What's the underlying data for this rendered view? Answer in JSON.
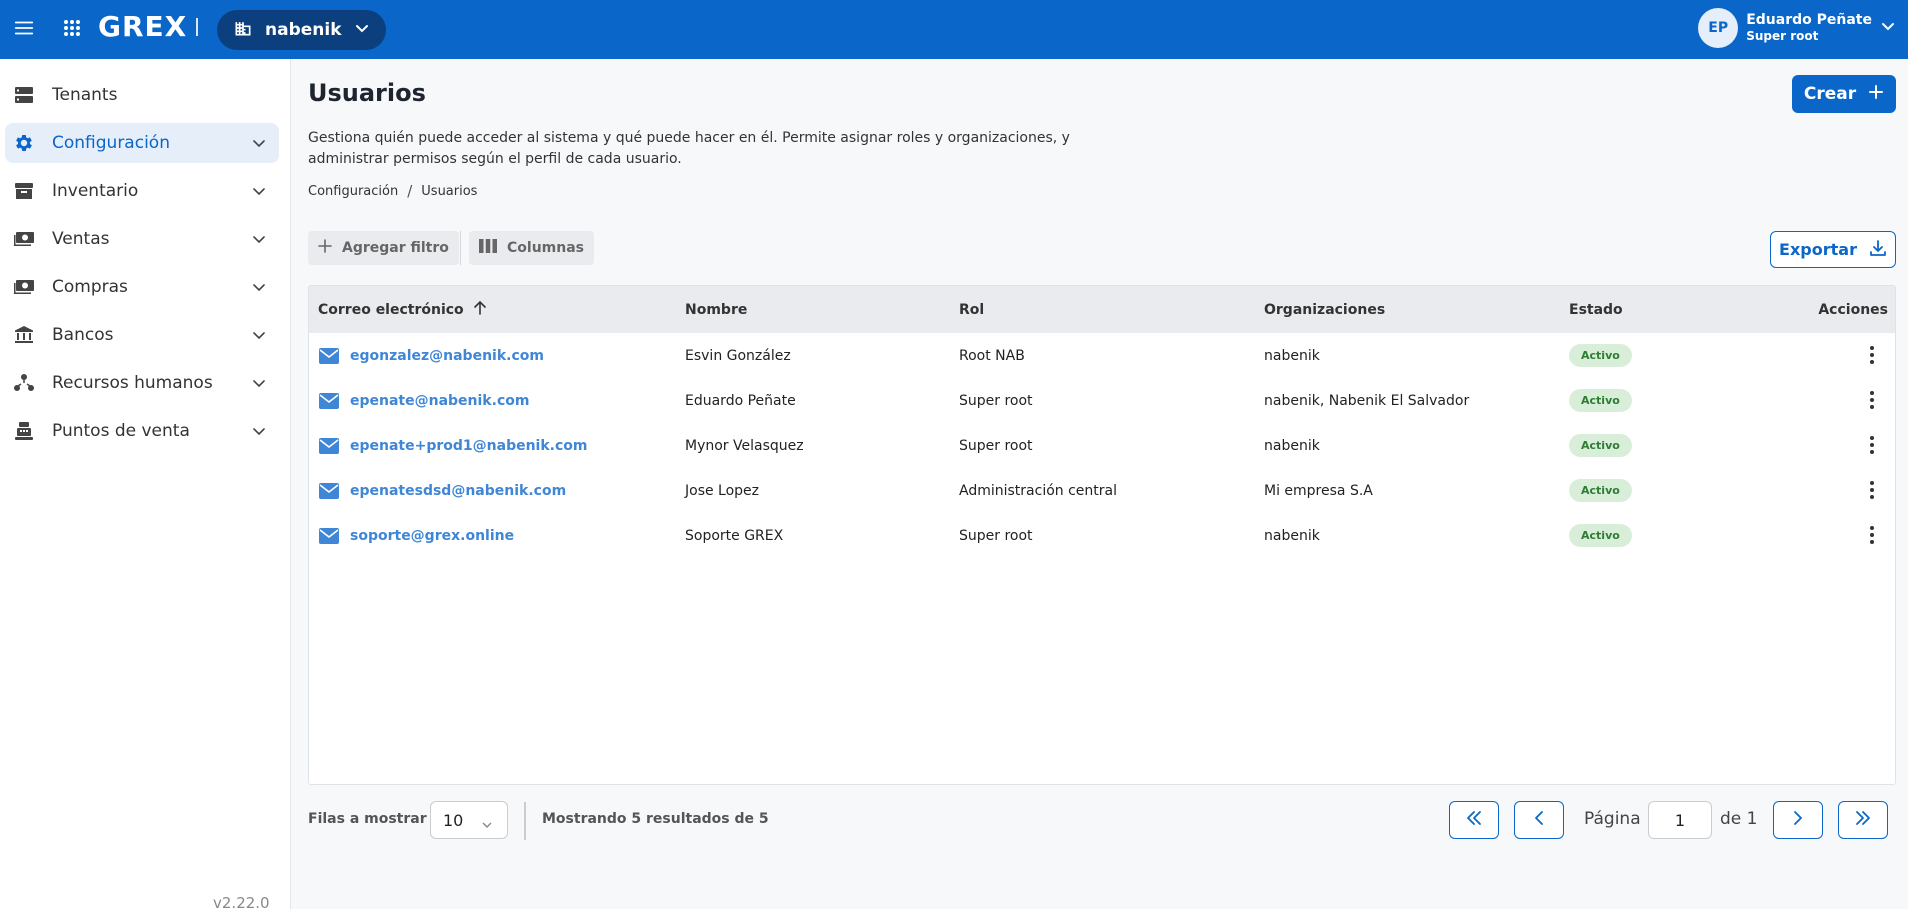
{
  "topbar": {
    "logo": "GREX",
    "tenant": "nabenik",
    "user": {
      "initials": "EP",
      "name": "Eduardo Peñate",
      "role": "Super root"
    }
  },
  "sidebar": {
    "items": [
      {
        "label": "Tenants",
        "icon": "server-icon"
      },
      {
        "label": "Configuración",
        "icon": "gear-icon"
      },
      {
        "label": "Inventario",
        "icon": "archive-box-icon"
      },
      {
        "label": "Ventas",
        "icon": "cash-icon"
      },
      {
        "label": "Compras",
        "icon": "cash-icon"
      },
      {
        "label": "Bancos",
        "icon": "bank-icon"
      },
      {
        "label": "Recursos humanos",
        "icon": "people-network-icon"
      },
      {
        "label": "Puntos de venta",
        "icon": "cash-register-icon"
      }
    ],
    "version": "v2.22.0"
  },
  "page": {
    "title": "Usuarios",
    "create_label": "Crear",
    "description": "Gestiona quién puede acceder al sistema y qué puede hacer en él. Permite asignar roles y organizaciones, y administrar permisos según el perfil de cada usuario.",
    "breadcrumb": [
      "Configuración",
      "Usuarios"
    ]
  },
  "toolbar": {
    "add_filter": "Agregar filtro",
    "columns": "Columnas",
    "export": "Exportar"
  },
  "table": {
    "headers": [
      "Correo electrónico",
      "Nombre",
      "Rol",
      "Organizaciones",
      "Estado",
      "Acciones"
    ],
    "rows": [
      {
        "email": "egonzalez@nabenik.com",
        "name": "Esvin González",
        "role": "Root NAB",
        "orgs": "nabenik",
        "status": "Activo"
      },
      {
        "email": "epenate@nabenik.com",
        "name": "Eduardo Peñate",
        "role": "Super root",
        "orgs": "nabenik, Nabenik El Salvador",
        "status": "Activo"
      },
      {
        "email": "epenate+prod1@nabenik.com",
        "name": "Mynor Velasquez",
        "role": "Super root",
        "orgs": "nabenik",
        "status": "Activo"
      },
      {
        "email": "epenatesdsd@nabenik.com",
        "name": "Jose Lopez",
        "role": "Administración central",
        "orgs": "Mi empresa S.A",
        "status": "Activo"
      },
      {
        "email": "soporte@grex.online",
        "name": "Soporte GREX",
        "role": "Super root",
        "orgs": "nabenik",
        "status": "Activo"
      }
    ]
  },
  "pagination": {
    "rows_label": "Filas a mostrar",
    "rows_value": "10",
    "showing": "Mostrando 5 resultados de 5",
    "page_label": "Página",
    "page_value": "1",
    "of_label": "de 1"
  },
  "colors": {
    "primary": "#0a66c8",
    "tenant_pill": "#0b3f7d",
    "link": "#3f86d6",
    "status_bg": "#d8eed9",
    "status_text": "#2e7d32"
  }
}
